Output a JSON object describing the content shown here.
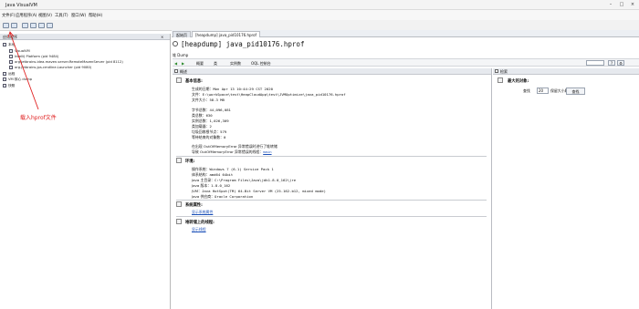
{
  "window": {
    "title": "Java VisualVM",
    "minimize": "–",
    "maximize": "□",
    "close": "×"
  },
  "menu": [
    "文件(F)",
    "应用程序(A)",
    "视图(V)",
    "工具(T)",
    "窗口(W)",
    "帮助(H)"
  ],
  "left_panel": {
    "header": "应用程序",
    "close": "×",
    "tree": [
      "本地",
      "VisualVM",
      "IntelliJ Platform (pid 9484)",
      "org.jetbrains.idea.maven.server.RemoteMavenServer (pid 8112)",
      "org.jetbrains.jps.cmdline.Launcher (pid 9080)",
      "远程",
      "VM 核心 dump",
      "快照"
    ]
  },
  "annotation": "载入hprof文件",
  "tabs": [
    "起始页",
    "[heapdump] java_pid10176.hprof"
  ],
  "document": {
    "title": "[heapdump] java_pid10176.hprof",
    "subheader": "堆 Dump",
    "nav": {
      "summary": "概要",
      "classes": "类",
      "instances": "实例数",
      "oql": "OQL 控制台"
    },
    "nav_buttons": [
      "?",
      "⚙"
    ]
  },
  "overview": {
    "pane_title": "概述",
    "sections": {
      "basic": {
        "title": "基本信息:",
        "lines": [
          {
            "label": "生成的日期：",
            "value": "Mon Apr 13 10:44:29 CST 2020"
          },
          {
            "label": "文件：",
            "value": "E:\\workSpace\\test\\HeapCloudApp\\test\\JVMOptimize\\java_pid10176.hprof"
          },
          {
            "label": "文件大小：",
            "value": "58.3 MB"
          },
          {
            "label": "字节总数：",
            "value": "44,096,081"
          },
          {
            "label": "类总数：",
            "value": "630"
          },
          {
            "label": "实例总数：",
            "value": "1,026,309"
          },
          {
            "label": "类加载器：",
            "value": "2"
          },
          {
            "label": "垃圾回收根节点：",
            "value": "579"
          },
          {
            "label": "等待结束的对象数：",
            "value": "0"
          },
          {
            "label": "在出现 OutOfMemoryError 异常错误时进行了堆转储",
            "value": ""
          },
          {
            "label": "导致 OutOfMemoryError 异常错误的线程：",
            "value": "main"
          }
        ]
      },
      "env": {
        "title": "环境:",
        "lines": [
          {
            "label": "操作系统：",
            "value": "Windows 7 (6.1) Service Pack 1"
          },
          {
            "label": "体系结构：",
            "value": "amd64 64bit"
          },
          {
            "label": "Java 主目录：",
            "value": "C:\\Program Files\\Java\\jdk1.8.0_162\\jre"
          },
          {
            "label": "Java 版本：",
            "value": "1.8.0_162"
          },
          {
            "label": "JVM：",
            "value": "Java HotSpot(TM) 64-Bit Server VM (25.162-b12, mixed mode)"
          },
          {
            "label": "Java 供应商：",
            "value": "Oracle Corporation"
          }
        ]
      },
      "sysprops": {
        "title": "系统属性:",
        "link": "显示系统属性"
      },
      "threads": {
        "title": "堆转储上的线程:",
        "link": "显示线程"
      }
    }
  },
  "retained": {
    "pane_title": "检索",
    "section_title": "最大的对象:",
    "find_label": "查找",
    "count": "20",
    "desc": "保留大小最大的对象",
    "button": "查找"
  }
}
